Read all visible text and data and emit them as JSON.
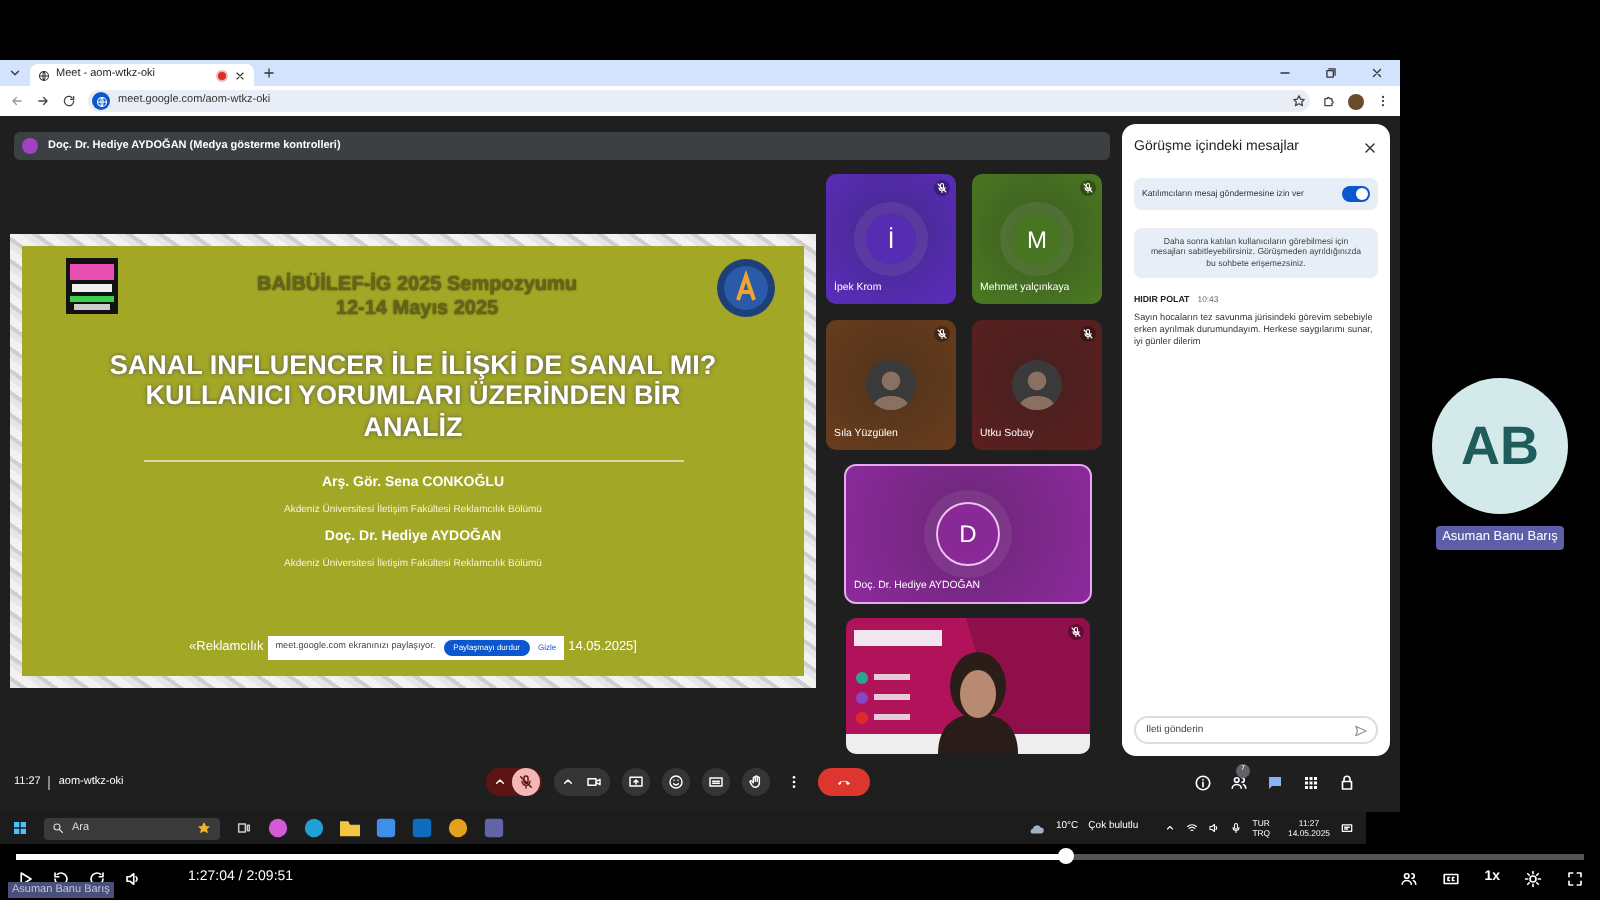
{
  "browser": {
    "tabs": [
      {
        "title": "Meet - aom-wtkz-oki",
        "selected": true,
        "recording": true
      }
    ],
    "url": "meet.google.com/aom-wtkz-oki"
  },
  "meet": {
    "banner": "Doç. Dr. Hediye AYDOĞAN (Medya gösterme kontrolleri)",
    "slide": {
      "heading": [
        "BAİBÜİLEF-İG 2025 Sempozyumu",
        "12-14 Mayıs 2025"
      ],
      "title_lines": [
        "SANAL INFLUENCER İLE İLİŞKİ DE SANAL MI?",
        "KULLANICI YORUMLARI ÜZERİNDEN BİR",
        "ANALİZ"
      ],
      "authors": [
        {
          "name": "Arş. Gör. Sena CONKOĞLU",
          "affiliation": "Akdeniz Üniversitesi İletişim Fakültesi Reklamcılık Bölümü"
        },
        {
          "name": "Doç. Dr. Hediye AYDOĞAN",
          "affiliation": "Akdeniz Üniversitesi İletişim Fakültesi Reklamcılık Bölümü"
        }
      ],
      "footer_left": "«Reklamcılık",
      "footer_right": "14.05.2025]"
    },
    "share_bar": {
      "message": "meet.google.com ekranınızı paylaşıyor.",
      "stop_button": "Paylaşmayı durdur",
      "hide_link": "Gizle"
    },
    "tiles": [
      {
        "kind": "initial",
        "name": "İpek Krom",
        "initial": "İ",
        "color": "#5a2dbd",
        "muted": true,
        "speaking": false
      },
      {
        "kind": "initial",
        "name": "Mehmet yalçınkaya",
        "initial": "M",
        "color": "#4b7a22",
        "muted": true,
        "speaking": false
      },
      {
        "name": "Sıla Yüzgülen",
        "color": "#6a3d1c",
        "muted": true,
        "speaking": false
      },
      {
        "name": "Utku Sobay",
        "color": "#5c1f1f",
        "muted": true,
        "speaking": false
      },
      {
        "kind": "initial",
        "name": "Doç. Dr. Hediye AYDOĞAN",
        "initial": "D",
        "color": "#8e2a9e",
        "muted": false,
        "speaking": true
      },
      {
        "kind": "video",
        "muted": true,
        "speaking": false
      }
    ],
    "chat": {
      "title": "Görüşme içindeki mesajlar",
      "permission": {
        "label": "Katılımcıların mesaj göndermesine izin ver",
        "on": true
      },
      "notice": "Daha sonra katılan kullanıcıların görebilmesi için mesajları sabitleyebilirsiniz. Görüşmeden ayrıldığınızda bu sohbete erişemezsiniz.",
      "messages": [
        {
          "sender": "HIDIR POLAT",
          "time": "10:43",
          "text": "Sayın hocaların tez savunma jürisindeki görevim sebebiyle erken ayrılmak durumundayım. Herkese saygılarımı sunar, iyi günler dilerim"
        }
      ],
      "input": {
        "placeholder": "İleti gönderin"
      }
    },
    "bottom_bar": {
      "time": "11:27",
      "meeting_code": "aom-wtkz-oki",
      "mic_on": false,
      "people_count": "7",
      "chat_open": true
    }
  },
  "taskbar": {
    "search": "Ara",
    "weather": {
      "temp": "10°C",
      "desc": "Çok bulutlu"
    },
    "language": [
      "TUR",
      "TRQ"
    ],
    "time": "11:27",
    "date": "14.05.2025"
  },
  "side_tile": {
    "initials": "AB",
    "name": "Asuman Banu Barış"
  },
  "player": {
    "level": 0.67,
    "time": "1:27:04 / 2:09:51",
    "speed": "1x",
    "caption": "Asuman Banu Barış"
  }
}
